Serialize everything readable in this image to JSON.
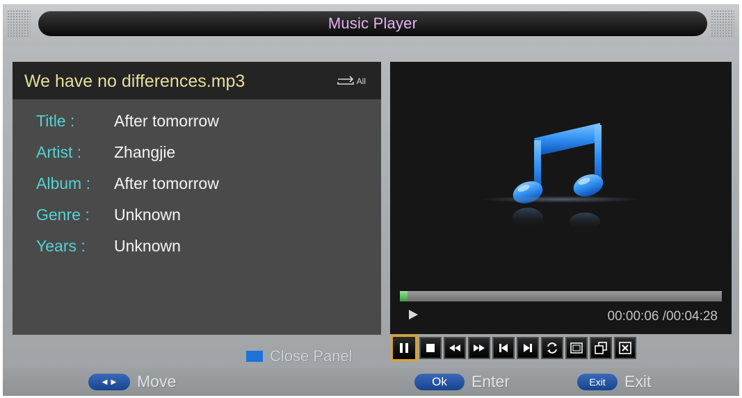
{
  "header": {
    "title": "Music Player"
  },
  "info": {
    "filename": "We have no differences.mp3",
    "repeat_mode": "All",
    "fields": [
      {
        "key": "Title :",
        "value": "After tomorrow"
      },
      {
        "key": "Artist :",
        "value": "Zhangjie"
      },
      {
        "key": "Album :",
        "value": "After tomorrow"
      },
      {
        "key": "Genre :",
        "value": "Unknown"
      },
      {
        "key": "Years :",
        "value": "Unknown"
      }
    ]
  },
  "player": {
    "artwork_icon": "music-note-icon",
    "progress_fraction": 0.023,
    "time": "00:00:06 /00:04:28",
    "state_icon": "play-icon"
  },
  "close_panel": {
    "label": "Close Panel",
    "color": "#1d73d8"
  },
  "controls": [
    {
      "name": "pause",
      "icon": "pause-icon",
      "active": true
    },
    {
      "name": "stop",
      "icon": "stop-icon"
    },
    {
      "name": "rewind",
      "icon": "rewind-icon"
    },
    {
      "name": "fast-forward",
      "icon": "fast-forward-icon"
    },
    {
      "name": "previous",
      "icon": "skip-previous-icon"
    },
    {
      "name": "next",
      "icon": "skip-next-icon"
    },
    {
      "name": "repeat",
      "icon": "repeat-icon"
    },
    {
      "name": "repeat-all",
      "icon": "repeat-all-icon"
    },
    {
      "name": "copy",
      "icon": "copy-icon"
    },
    {
      "name": "close",
      "icon": "close-icon"
    }
  ],
  "footer": {
    "move": {
      "key": "◄►",
      "label": "Move"
    },
    "enter": {
      "key": "Ok",
      "label": "Enter"
    },
    "exit": {
      "key": "Exit",
      "label": "Exit"
    }
  },
  "colors": {
    "accent": "#e0a020",
    "title": "#e6b3f0",
    "field_key": "#55d2d2",
    "filename": "#e7df9c"
  }
}
